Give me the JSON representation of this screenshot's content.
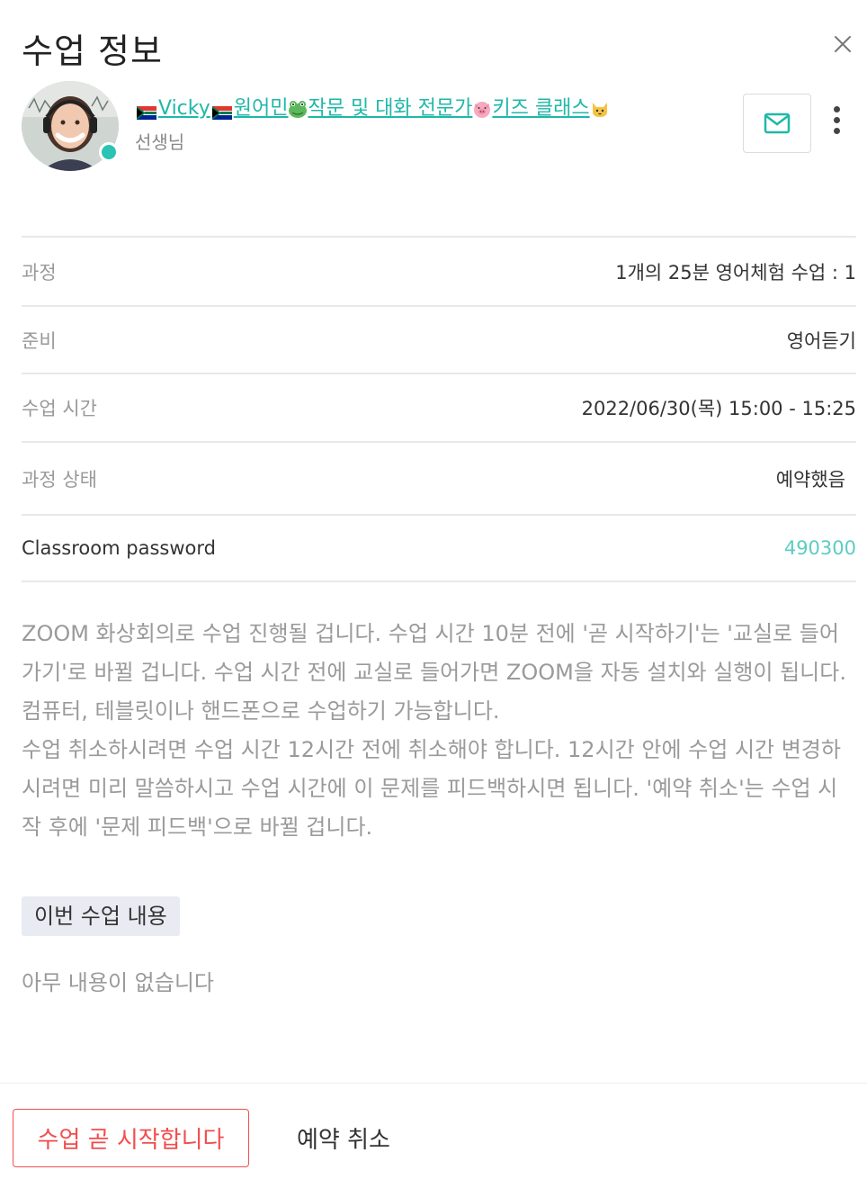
{
  "header": {
    "title": "수업 정보"
  },
  "teacher": {
    "name_parts": [
      "Vicky",
      "원어민",
      "작문 및 대화 전문가",
      "키즈 클래스"
    ],
    "role": "선생님",
    "status_color": "#2bc3b4"
  },
  "info_rows": [
    {
      "label": "과정",
      "value": "1개의 25분 영어체험 수업 : 1"
    },
    {
      "label": "준비",
      "value": "영어듣기"
    },
    {
      "label": "수업 시간",
      "value": "2022/06/30(목) 15:00 - 15:25"
    },
    {
      "label": "과정 상태",
      "value": "예약했음"
    },
    {
      "label": "Classroom password",
      "value": "490300"
    }
  ],
  "description": {
    "paragraph1": "ZOOM 화상회의로 수업 진행될 겁니다. 수업 시간 10분 전에 '곧 시작하기'는 '교실로 들어가기'로 바뀔 겁니다. 수업 시간 전에 교실로 들어가면 ZOOM을 자동 설치와 실행이 됩니다. 컴퓨터, 테블릿이나 핸드폰으로 수업하기 가능합니다.",
    "paragraph2": "수업 취소하시려면 수업 시간 12시간 전에 취소해야 합니다. 12시간 안에 수업 시간 변경하시려면 미리 말씀하시고 수업 시간에 이 문제를 피드백하시면 됩니다. '예약 취소'는 수업 시작 후에 '문제 피드백'으로 바뀔 겁니다."
  },
  "lesson_content": {
    "section_label": "이번 수업 내용",
    "empty_text": "아무 내용이 없습니다"
  },
  "footer": {
    "start_label": "수업 곧 시작합니다",
    "cancel_label": "예약 취소"
  },
  "colors": {
    "accent": "#1fb8a8",
    "danger": "#f24e4e"
  }
}
